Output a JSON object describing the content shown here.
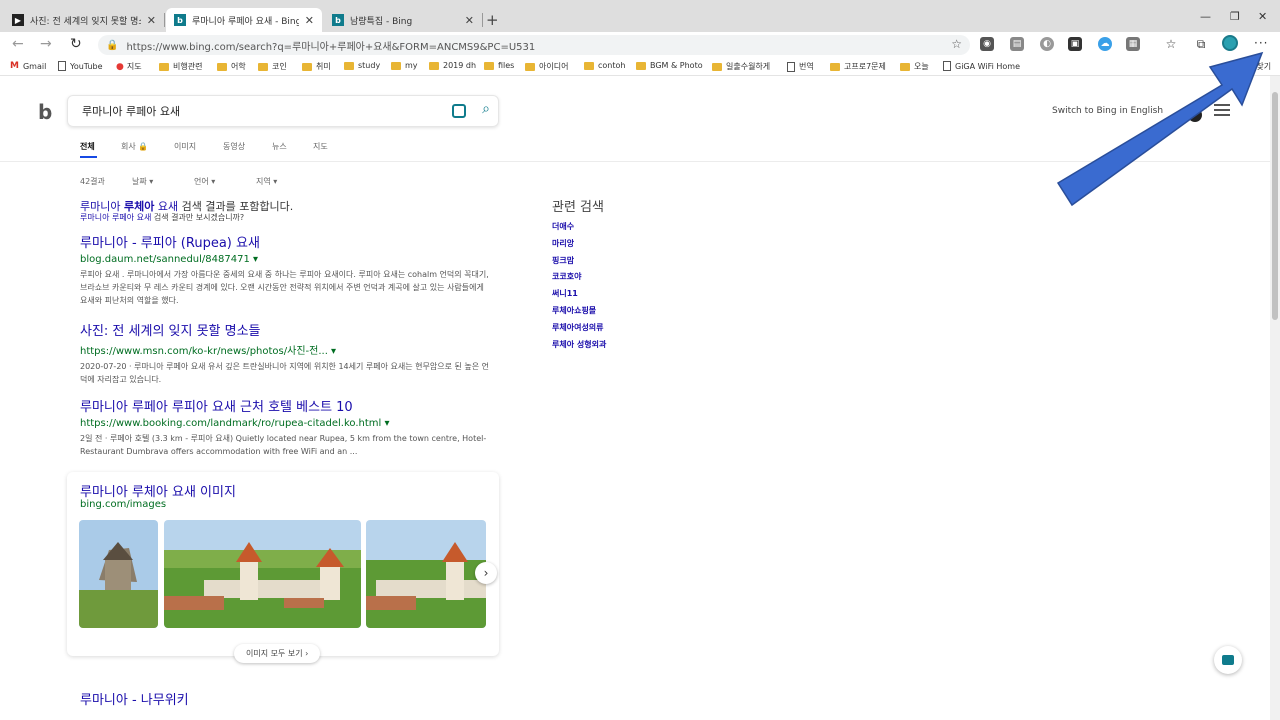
{
  "tabs": [
    {
      "title": "사진: 전 세계의 잊지 못할 명소들",
      "favicon": "msn"
    },
    {
      "title": "루마니아 루페아 요새 - Bing",
      "favicon": "b"
    },
    {
      "title": "남량특집 - Bing",
      "favicon": "b"
    }
  ],
  "address": {
    "url": "https://www.bing.com/search?q=루마니아+루페아+요새&FORM=ANCMS9&PC=U531"
  },
  "bookmarks": [
    {
      "label": "Gmail",
      "icon": "gmail-icon"
    },
    {
      "label": "YouTube",
      "icon": "page-icon"
    },
    {
      "label": "지도",
      "icon": "map-pin-icon"
    },
    {
      "label": "비행관련",
      "icon": "folder-icon"
    },
    {
      "label": "어학",
      "icon": "folder-icon"
    },
    {
      "label": "코인",
      "icon": "folder-icon"
    },
    {
      "label": "취미",
      "icon": "folder-icon"
    },
    {
      "label": "study",
      "icon": "folder-icon"
    },
    {
      "label": "my",
      "icon": "folder-icon"
    },
    {
      "label": "2019 dh",
      "icon": "folder-icon"
    },
    {
      "label": "files",
      "icon": "folder-icon"
    },
    {
      "label": "아이디어",
      "icon": "folder-icon"
    },
    {
      "label": "contoh",
      "icon": "folder-icon"
    },
    {
      "label": "BGM & Photo",
      "icon": "folder-icon"
    },
    {
      "label": "일출수월하게",
      "icon": "folder-icon"
    },
    {
      "label": "번역",
      "icon": "page-icon"
    },
    {
      "label": "고프로7문제",
      "icon": "folder-icon"
    },
    {
      "label": "오늘",
      "icon": "folder-icon"
    },
    {
      "label": "GiGA WiFi Home",
      "icon": "page-icon"
    },
    {
      "label": "겨찾기",
      "icon": "folder-icon"
    }
  ],
  "search": {
    "query": "루마니아 루페아 요새"
  },
  "header": {
    "switch_label": "Switch to Bing in English"
  },
  "scopes": [
    "전체",
    "회사 🔒",
    "이미지",
    "동영상",
    "뉴스",
    "지도"
  ],
  "filters": {
    "count": "42결과",
    "date": "날짜 ▾",
    "lang": "언어 ▾",
    "region": "지역 ▾"
  },
  "spell": {
    "line1_pre": "루마니아 ",
    "line1_bold": "루체아",
    "line1_mid": " 요새",
    "line1_post": " 검색 결과를 포함합니다.",
    "line2_link": "루마니아 루페아 요새",
    "line2_post": " 검색 결과만 보시겠습니까?"
  },
  "results": [
    {
      "title": "루마니아 - 루피아 (Rupea) 요새",
      "url": "blog.daum.net/sannedul/8487471 ▾",
      "snippet": "루피아 요새 . 루마니아에서 가장 아름다운 중세의 요새 중 하나는 루피아 요새이다. 루피아 요새는 cohalm 언덕의 꼭대기, 브라쇼브 카운티와 무 레스 카운티 경계에 있다. 오랜 시간동안 전략적 위치에서 주변 언덕과 계곡에 살고 있는 사람들에게 요새와 피난처의 역할을 했다."
    },
    {
      "title": "사진: 전 세계의 잊지 못할 명소들",
      "url": "https://www.msn.com/ko-kr/news/photos/사진-전... ▾",
      "snippet": "2020-07-20 · 루마니아 루페아 요새 유서 깊은 트란실바니아 지역에 위치한 14세기 루페아 요새는 현무암으로 된 높은 언덕에 자리잡고 있습니다."
    },
    {
      "title": "루마니아 루페아 루피아 요새 근처 호텔 베스트 10",
      "url": "https://www.booking.com/landmark/ro/rupea-citadel.ko.html ▾",
      "snippet": "2일 전 · 루페아 호텔 (3.3 km - 루피아 요새) Quietly located near Rupea, 5 km from the town centre, Hotel-Restaurant Dumbrava offers accommodation with free WiFi and an ..."
    }
  ],
  "images_card": {
    "title": "루마니아 루체아 요새 이미지",
    "url": "bing.com/images",
    "see_all": "이미지 모두 보기 ›"
  },
  "related": {
    "heading": "관련 검색",
    "items": [
      "더애수",
      "마리앙",
      "핑크맘",
      "코코호야",
      "써니11",
      "루체아쇼핑몰",
      "루체아여성의류",
      "루체아 성형외과"
    ]
  },
  "last_result": {
    "title": "루마니아 - 나무위키"
  },
  "colors": {
    "link": "#1a0dab",
    "url": "#006d21",
    "accent": "#0f7b8c",
    "arrow": "#3a6bd0"
  }
}
